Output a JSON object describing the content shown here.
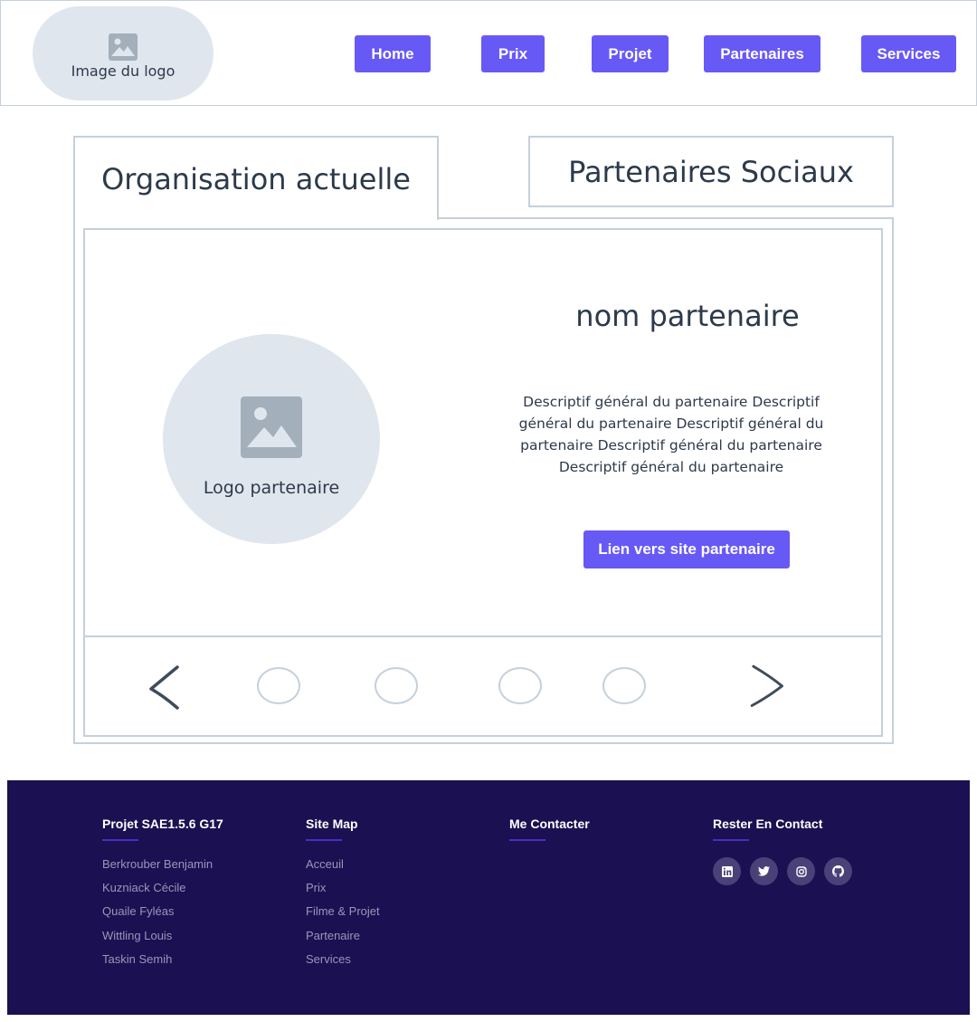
{
  "header": {
    "logo_label": "Image du logo",
    "nav": [
      {
        "label": "Home"
      },
      {
        "label": "Prix"
      },
      {
        "label": "Projet"
      },
      {
        "label": "Partenaires"
      },
      {
        "label": "Services"
      }
    ]
  },
  "tabs": [
    {
      "label": "Organisation actuelle",
      "active": true
    },
    {
      "label": "Partenaires Sociaux",
      "active": false
    }
  ],
  "partner": {
    "logo_label": "Logo partenaire",
    "name": "nom partenaire",
    "description": "Descriptif général du partenaire Descriptif général du partenaire Descriptif général du partenaire Descriptif général du partenaire Descriptif général du partenaire",
    "link_label": "Lien vers site partenaire"
  },
  "carousel": {
    "prev_icon": "chevron-left-icon",
    "next_icon": "chevron-right-icon",
    "dot_count": 4
  },
  "footer": {
    "columns": [
      {
        "title": "Projet SAE1.5.6 G17",
        "items": [
          "Berkrouber Benjamin",
          "Kuzniack Cécile",
          "Quaile Fyléas",
          "Wittling Louis",
          "Taskin Semih"
        ]
      },
      {
        "title": "Site Map",
        "items": [
          "Acceuil",
          "Prix",
          "Filme & Projet",
          "Partenaire",
          "Services"
        ]
      },
      {
        "title": "Me Contacter",
        "items": []
      },
      {
        "title": "Rester En Contact",
        "social": [
          "linkedin-icon",
          "twitter-icon",
          "instagram-icon",
          "github-icon"
        ]
      }
    ]
  },
  "colors": {
    "accent": "#6759f6",
    "footer_bg": "#1b1051",
    "placeholder_bg": "#e0e6ee",
    "border": "#c5d0dc"
  }
}
